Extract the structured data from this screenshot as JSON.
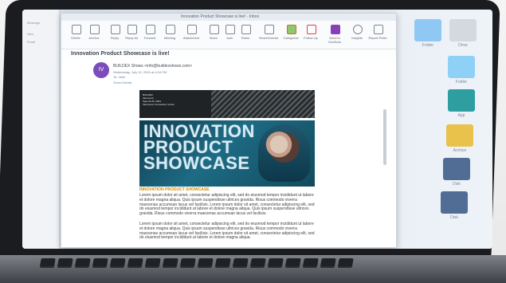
{
  "window": {
    "title": "Innovation Product Showcase is live! - Inbox",
    "left_labels": [
      "Message",
      "New",
      "Email"
    ]
  },
  "ribbon": {
    "buttons": [
      {
        "label": "Delete",
        "icon": "trash-icon"
      },
      {
        "label": "Archive",
        "icon": "archive-icon"
      },
      {
        "label": "Reply",
        "icon": "reply-icon"
      },
      {
        "label": "Reply All",
        "icon": "reply-all-icon"
      },
      {
        "label": "Forward",
        "icon": "forward-icon"
      },
      {
        "label": "Meeting",
        "icon": "meeting-icon"
      },
      {
        "label": "Attachment",
        "icon": "attachment-icon"
      },
      {
        "label": "Move",
        "icon": "move-icon"
      },
      {
        "label": "Junk",
        "icon": "junk-icon"
      },
      {
        "label": "Rules",
        "icon": "rules-icon"
      },
      {
        "label": "Read/Unread",
        "icon": "read-icon"
      },
      {
        "label": "Categorize",
        "icon": "categorize-icon"
      },
      {
        "label": "Follow Up",
        "icon": "flag-icon"
      },
      {
        "label": "Send to OneNote",
        "icon": "onenote-icon"
      },
      {
        "label": "Insights",
        "icon": "insights-icon"
      },
      {
        "label": "Report Phish",
        "icon": "phish-icon"
      }
    ]
  },
  "email": {
    "subject": "Innovation Product Showcase is live!",
    "avatar": "IV",
    "sender": "BUILDEX Shows <info@buildexshows.com>",
    "date": "Wednesday, July 10, 2024 at 4:16 PM",
    "to": "To: Jane",
    "details": "Show Details"
  },
  "newsletter": {
    "hero_small_text": [
      "BUILDEX",
      "Vancouver",
      "Sept 24-26, 2024",
      "Vancouver Convention Centre"
    ],
    "headline_lines": [
      "INNOVATION",
      "PRODUCT",
      "SHOWCASE"
    ],
    "section_title": "INNOVATION PRODUCT SHOWCASE",
    "paragraph_1": "Lorem ipsum dolor sit amet, consectetur adipiscing elit, sed do eiusmod tempor incididunt ut labore et dolore magna aliqua. Quis ipsum suspendisse ultrices gravida. Risus commodo viverra maecenas accumsan lacus vel facilisis. Lorem ipsum dolor sit amet, consectetur adipiscing elit, sed do eiusmod tempor incididunt ut labore et dolore magna aliqua. Quis ipsum suspendisse ultrices gravida. Risus commodo viverra maecenas accumsan lacus vel facilisis.",
    "paragraph_2": "Lorem ipsum dolor sit amet, consectetur adipiscing elit, sed do eiusmod tempor incididunt ut labore et dolore magna aliqua. Quis ipsum suspendisse ultrices gravida. Risus commodo viverra maecenas accumsan lacus vel facilisis. Lorem ipsum dolor sit amet, consectetur adipiscing elit, sed do eiusmod tempor incididunt ut labore et dolore magna aliqua."
  },
  "desktop": {
    "labels": [
      "Folder",
      "Drive",
      "Folder",
      "App",
      "Archive",
      "Disk",
      "Disk"
    ]
  },
  "colors": {
    "accent": "#7b4dbb",
    "headline": "#d7ecf4",
    "section": "#d18a00"
  }
}
